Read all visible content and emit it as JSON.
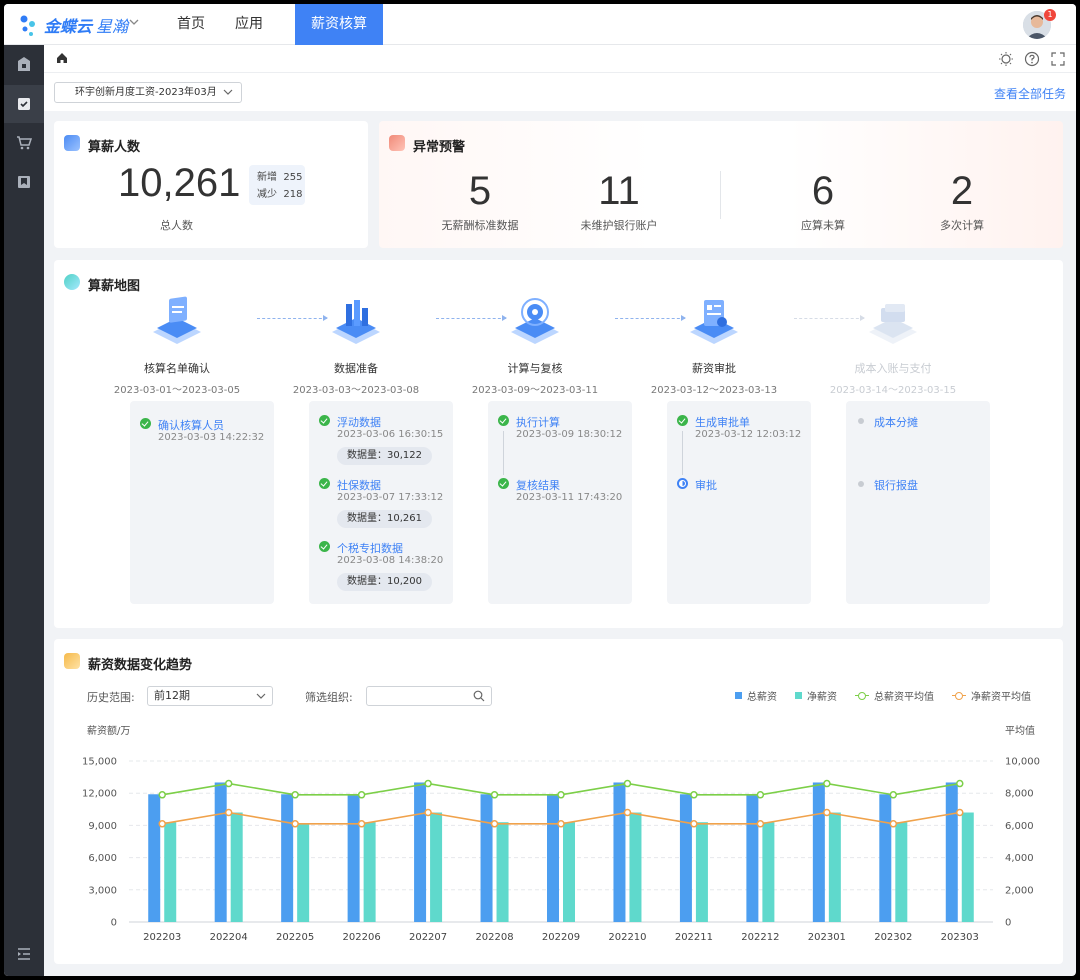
{
  "app": {
    "logo_text": "金蝶云",
    "logo_sub": "星瀚",
    "nav": [
      {
        "label": "首页"
      },
      {
        "label": "应用"
      },
      {
        "label": "薪资核算"
      }
    ],
    "notification_count": "1"
  },
  "toolbar": {
    "period_select": "环宇创新月度工资-2023年03月",
    "view_all": "查看全部任务"
  },
  "headcount": {
    "title": "算薪人数",
    "total": "10,261",
    "total_label": "总人数",
    "added_label": "新增",
    "added": "255",
    "reduced_label": "减少",
    "reduced": "218"
  },
  "alerts": {
    "title": "异常预警",
    "items": [
      {
        "value": "5",
        "label": "无薪酬标准数据"
      },
      {
        "value": "11",
        "label": "未维护银行账户"
      },
      {
        "value": "6",
        "label": "应算未算"
      },
      {
        "value": "2",
        "label": "多次计算"
      }
    ]
  },
  "map": {
    "title": "算薪地图",
    "count_label": "数据量：",
    "stages": [
      {
        "name": "核算名单确认",
        "date": "2023-03-01～2023-03-05"
      },
      {
        "name": "数据准备",
        "date": "2023-03-03～2023-03-08"
      },
      {
        "name": "计算与复核",
        "date": "2023-03-09～2023-03-11"
      },
      {
        "name": "薪资审批",
        "date": "2023-03-12～2023-03-13"
      },
      {
        "name": "成本入账与支付",
        "date": "2023-03-14～2023-03-15"
      }
    ],
    "tasks": {
      "confirm": {
        "title": "确认核算人员",
        "time": "2023-03-03 14:22:32"
      },
      "float": {
        "title": "浮动数据",
        "time": "2023-03-06 16:30:15",
        "count": "30,122"
      },
      "social": {
        "title": "社保数据",
        "time": "2023-03-07 17:33:12",
        "count": "10,261"
      },
      "tax": {
        "title": "个税专扣数据",
        "time": "2023-03-08 14:38:20",
        "count": "10,200"
      },
      "calc": {
        "title": "执行计算",
        "time": "2023-03-09 18:30:12"
      },
      "review": {
        "title": "复核结果",
        "time": "2023-03-11 17:43:20"
      },
      "gen": {
        "title": "生成审批单",
        "time": "2023-03-12 12:03:12"
      },
      "approve": {
        "title": "审批"
      },
      "cost": {
        "title": "成本分摊"
      },
      "bank": {
        "title": "银行报盘"
      }
    }
  },
  "trend": {
    "title": "薪资数据变化趋势",
    "range_label": "历史范围:",
    "range_value": "前12期",
    "org_label": "筛选组织:",
    "org_value": ""
  },
  "colors": {
    "accent": "#3f82f5",
    "gross": "#4c9ef0",
    "net": "#5fd9cc",
    "gross_avg": "#7ccf48",
    "net_avg": "#f0a24b",
    "ok": "#3bb54a"
  },
  "chart_data": {
    "type": "bar",
    "title": "",
    "ylabel": "薪资额/万",
    "y2label": "平均值",
    "categories": [
      "202203",
      "202204",
      "202205",
      "202206",
      "202207",
      "202208",
      "202209",
      "202210",
      "202211",
      "202212",
      "202301",
      "202302",
      "202303"
    ],
    "ylim": [
      0,
      15000
    ],
    "yticks": [
      "0",
      "3,000",
      "6,000",
      "9,000",
      "12,000",
      "15,000"
    ],
    "y2lim": [
      0,
      10000
    ],
    "y2ticks": [
      "0",
      "2,000",
      "4,000",
      "6,000",
      "8,000",
      "10,000"
    ],
    "series": [
      {
        "name": "总薪资",
        "type": "bar",
        "values": [
          11900,
          13000,
          11900,
          11800,
          13000,
          11900,
          11800,
          13000,
          11900,
          11900,
          13000,
          11900,
          13000
        ]
      },
      {
        "name": "净薪资",
        "type": "bar",
        "values": [
          9300,
          10200,
          9200,
          9300,
          10200,
          9300,
          9300,
          10200,
          9300,
          9300,
          10200,
          9300,
          10200
        ]
      },
      {
        "name": "总薪资平均值",
        "type": "line",
        "axis": "y2",
        "values": [
          7900,
          8600,
          7900,
          7900,
          8600,
          7900,
          7900,
          8600,
          7900,
          7900,
          8600,
          7900,
          8600
        ]
      },
      {
        "name": "净薪资平均值",
        "type": "line",
        "axis": "y2",
        "values": [
          6100,
          6800,
          6100,
          6100,
          6800,
          6100,
          6100,
          6800,
          6100,
          6100,
          6800,
          6100,
          6800
        ]
      }
    ],
    "grid": true,
    "legend": "top-right"
  }
}
